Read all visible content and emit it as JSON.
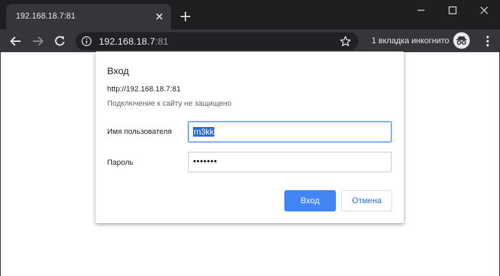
{
  "browser": {
    "tab": {
      "title": "192.168.18.7:81"
    },
    "omnibox": {
      "host": "192.168.18.7",
      "port": ":81"
    },
    "incognito_label": "1 вкладка инкогнито"
  },
  "colors": {
    "accent": "#4285f4",
    "chrome_dark": "#1f1f21",
    "toolbar": "#35363a"
  },
  "dialog": {
    "title": "Вход",
    "url": "http://192.168.18.7:81",
    "warning": "Подключение к сайту не защищено",
    "username_label": "Имя пользователя",
    "username_value": "rn3kk",
    "password_label": "Пароль",
    "password_value": "•••••••",
    "sign_in_label": "Вход",
    "cancel_label": "Отмена"
  }
}
